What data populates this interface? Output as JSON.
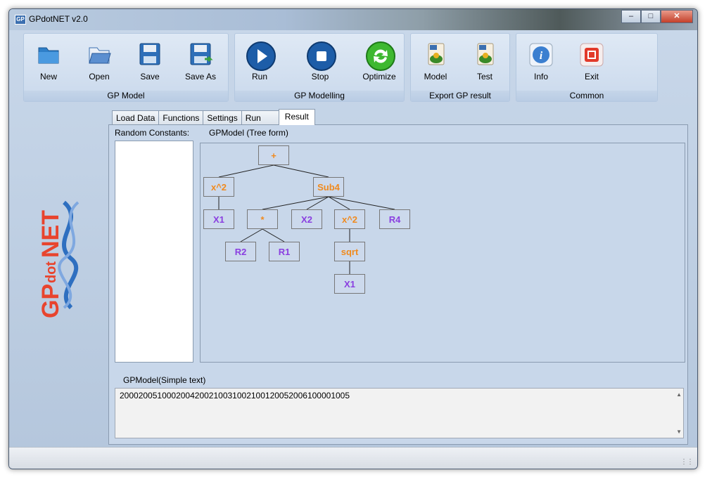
{
  "window": {
    "title": "GPdotNET v2.0",
    "icon_text": "GP"
  },
  "toolbar": {
    "groups": [
      {
        "label": "GP Model",
        "buttons": [
          {
            "label": "New",
            "icon": "folder-icon"
          },
          {
            "label": "Open",
            "icon": "folder-open-icon"
          },
          {
            "label": "Save",
            "icon": "floppy-icon"
          },
          {
            "label": "Save As",
            "icon": "floppy-save-as-icon"
          }
        ]
      },
      {
        "label": "GP Modelling",
        "buttons": [
          {
            "label": "Run",
            "icon": "play-icon"
          },
          {
            "label": "Stop",
            "icon": "stop-icon"
          },
          {
            "label": "Optimize",
            "icon": "refresh-icon"
          }
        ]
      },
      {
        "label": "Export GP result",
        "buttons": [
          {
            "label": "Model",
            "icon": "export-model-icon"
          },
          {
            "label": "Test",
            "icon": "export-test-icon"
          }
        ]
      },
      {
        "label": "Common",
        "buttons": [
          {
            "label": "Info",
            "icon": "info-icon"
          },
          {
            "label": "Exit",
            "icon": "exit-icon"
          }
        ]
      }
    ]
  },
  "logo": {
    "text": "GPdotNET",
    "gp": "GP",
    "dot": "dot",
    "net": "NET"
  },
  "tabs": [
    "Load Data",
    "Functions",
    "Settings",
    "Run",
    "Result"
  ],
  "active_tab": "Result",
  "result": {
    "random_constants_label": "Random Constants:",
    "tree_label": "GPModel (Tree form)",
    "simple_label": "GPModel(Simple text)",
    "simple_text": "2000200510002004200210031002100120052006100001005",
    "tree_nodes": {
      "root": "+",
      "n1": "x^2",
      "n2": "Sub4",
      "n3": "X1",
      "n4": "*",
      "n5": "X2",
      "n6": "x^2",
      "n7": "R4",
      "n8": "R2",
      "n9": "R1",
      "n10": "sqrt",
      "n11": "X1"
    }
  },
  "colors": {
    "operator": "#f08a1e",
    "terminal": "#8a3ee0",
    "logo_red": "#e8442e",
    "logo_blue": "#2e6fc0"
  }
}
